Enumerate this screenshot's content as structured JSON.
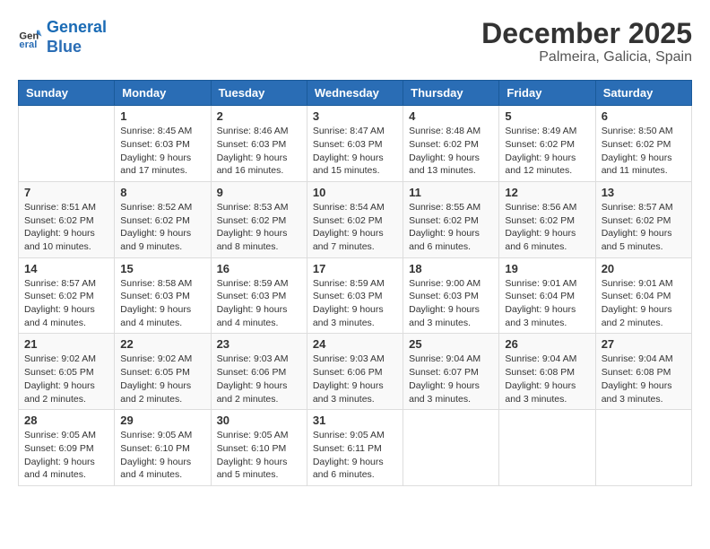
{
  "header": {
    "logo_line1": "General",
    "logo_line2": "Blue",
    "title": "December 2025",
    "subtitle": "Palmeira, Galicia, Spain"
  },
  "weekdays": [
    "Sunday",
    "Monday",
    "Tuesday",
    "Wednesday",
    "Thursday",
    "Friday",
    "Saturday"
  ],
  "weeks": [
    [
      {
        "day": "",
        "info": ""
      },
      {
        "day": "1",
        "info": "Sunrise: 8:45 AM\nSunset: 6:03 PM\nDaylight: 9 hours\nand 17 minutes."
      },
      {
        "day": "2",
        "info": "Sunrise: 8:46 AM\nSunset: 6:03 PM\nDaylight: 9 hours\nand 16 minutes."
      },
      {
        "day": "3",
        "info": "Sunrise: 8:47 AM\nSunset: 6:03 PM\nDaylight: 9 hours\nand 15 minutes."
      },
      {
        "day": "4",
        "info": "Sunrise: 8:48 AM\nSunset: 6:02 PM\nDaylight: 9 hours\nand 13 minutes."
      },
      {
        "day": "5",
        "info": "Sunrise: 8:49 AM\nSunset: 6:02 PM\nDaylight: 9 hours\nand 12 minutes."
      },
      {
        "day": "6",
        "info": "Sunrise: 8:50 AM\nSunset: 6:02 PM\nDaylight: 9 hours\nand 11 minutes."
      }
    ],
    [
      {
        "day": "7",
        "info": "Sunrise: 8:51 AM\nSunset: 6:02 PM\nDaylight: 9 hours\nand 10 minutes."
      },
      {
        "day": "8",
        "info": "Sunrise: 8:52 AM\nSunset: 6:02 PM\nDaylight: 9 hours\nand 9 minutes."
      },
      {
        "day": "9",
        "info": "Sunrise: 8:53 AM\nSunset: 6:02 PM\nDaylight: 9 hours\nand 8 minutes."
      },
      {
        "day": "10",
        "info": "Sunrise: 8:54 AM\nSunset: 6:02 PM\nDaylight: 9 hours\nand 7 minutes."
      },
      {
        "day": "11",
        "info": "Sunrise: 8:55 AM\nSunset: 6:02 PM\nDaylight: 9 hours\nand 6 minutes."
      },
      {
        "day": "12",
        "info": "Sunrise: 8:56 AM\nSunset: 6:02 PM\nDaylight: 9 hours\nand 6 minutes."
      },
      {
        "day": "13",
        "info": "Sunrise: 8:57 AM\nSunset: 6:02 PM\nDaylight: 9 hours\nand 5 minutes."
      }
    ],
    [
      {
        "day": "14",
        "info": "Sunrise: 8:57 AM\nSunset: 6:02 PM\nDaylight: 9 hours\nand 4 minutes."
      },
      {
        "day": "15",
        "info": "Sunrise: 8:58 AM\nSunset: 6:03 PM\nDaylight: 9 hours\nand 4 minutes."
      },
      {
        "day": "16",
        "info": "Sunrise: 8:59 AM\nSunset: 6:03 PM\nDaylight: 9 hours\nand 4 minutes."
      },
      {
        "day": "17",
        "info": "Sunrise: 8:59 AM\nSunset: 6:03 PM\nDaylight: 9 hours\nand 3 minutes."
      },
      {
        "day": "18",
        "info": "Sunrise: 9:00 AM\nSunset: 6:03 PM\nDaylight: 9 hours\nand 3 minutes."
      },
      {
        "day": "19",
        "info": "Sunrise: 9:01 AM\nSunset: 6:04 PM\nDaylight: 9 hours\nand 3 minutes."
      },
      {
        "day": "20",
        "info": "Sunrise: 9:01 AM\nSunset: 6:04 PM\nDaylight: 9 hours\nand 2 minutes."
      }
    ],
    [
      {
        "day": "21",
        "info": "Sunrise: 9:02 AM\nSunset: 6:05 PM\nDaylight: 9 hours\nand 2 minutes."
      },
      {
        "day": "22",
        "info": "Sunrise: 9:02 AM\nSunset: 6:05 PM\nDaylight: 9 hours\nand 2 minutes."
      },
      {
        "day": "23",
        "info": "Sunrise: 9:03 AM\nSunset: 6:06 PM\nDaylight: 9 hours\nand 2 minutes."
      },
      {
        "day": "24",
        "info": "Sunrise: 9:03 AM\nSunset: 6:06 PM\nDaylight: 9 hours\nand 3 minutes."
      },
      {
        "day": "25",
        "info": "Sunrise: 9:04 AM\nSunset: 6:07 PM\nDaylight: 9 hours\nand 3 minutes."
      },
      {
        "day": "26",
        "info": "Sunrise: 9:04 AM\nSunset: 6:08 PM\nDaylight: 9 hours\nand 3 minutes."
      },
      {
        "day": "27",
        "info": "Sunrise: 9:04 AM\nSunset: 6:08 PM\nDaylight: 9 hours\nand 3 minutes."
      }
    ],
    [
      {
        "day": "28",
        "info": "Sunrise: 9:05 AM\nSunset: 6:09 PM\nDaylight: 9 hours\nand 4 minutes."
      },
      {
        "day": "29",
        "info": "Sunrise: 9:05 AM\nSunset: 6:10 PM\nDaylight: 9 hours\nand 4 minutes."
      },
      {
        "day": "30",
        "info": "Sunrise: 9:05 AM\nSunset: 6:10 PM\nDaylight: 9 hours\nand 5 minutes."
      },
      {
        "day": "31",
        "info": "Sunrise: 9:05 AM\nSunset: 6:11 PM\nDaylight: 9 hours\nand 6 minutes."
      },
      {
        "day": "",
        "info": ""
      },
      {
        "day": "",
        "info": ""
      },
      {
        "day": "",
        "info": ""
      }
    ]
  ]
}
